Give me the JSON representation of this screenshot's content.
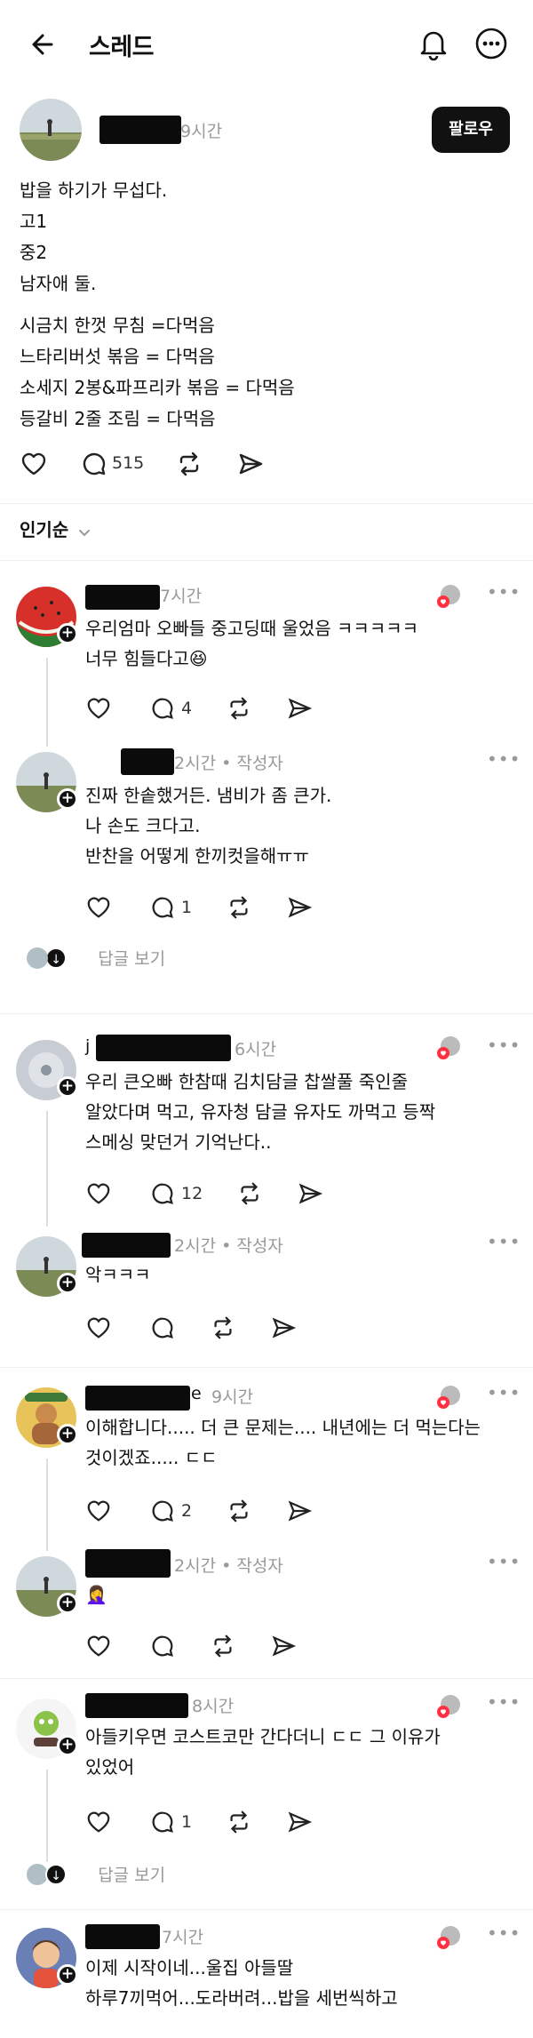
{
  "header": {
    "title": "스레드",
    "follow_label": "팔로우",
    "post_time": "9시간"
  },
  "post": {
    "lines": [
      "밥을 하기가 무섭다.",
      "고1",
      "중2",
      "남자애 둘.",
      "",
      "시금치 한껏  무침 =다먹음",
      "느타리버섯 볶음 = 다먹음",
      "소세지 2봉&파프리카 볶음 = 다먹음",
      "등갈비 2줄 조림 = 다먹음"
    ],
    "reply_count": "515"
  },
  "sort": {
    "label": "인기순"
  },
  "comments": [
    {
      "time": "7시간",
      "text": [
        "우리엄마 오빠들 중고딩때 울었음 ㅋㅋㅋㅋㅋ",
        "너무 힘들다고😆"
      ],
      "reply_count": "4"
    },
    {
      "time": "2시간 • 작성자",
      "text": [
        "진짜 한솥했거든. 냄비가 좀 큰가.",
        "나 손도 크다고.",
        "반찬을 어떻게 한끼컷을해ㅠㅠ"
      ],
      "reply_count": "1"
    },
    {
      "time": "6시간",
      "prefix": "j",
      "text": [
        "우리 큰오빠 한참때 김치담글 찹쌀풀 죽인줄",
        "알았다며 먹고, 유자청 담글 유자도 까먹고 등짝",
        "스메싱 맞던거 기억난다.."
      ],
      "reply_count": "12"
    },
    {
      "time": "2시간 • 작성자",
      "text": [
        "악ㅋㅋㅋ"
      ],
      "reply_count": ""
    },
    {
      "time": "9시간",
      "suffix": "e",
      "text": [
        "이해합니다..... 더 큰 문제는.... 내년에는 더 먹는다는",
        "것이겠죠..... ㄷㄷ"
      ],
      "reply_count": "2"
    },
    {
      "time": "2시간 • 작성자",
      "text": [
        "🤦‍♀️"
      ],
      "reply_count": ""
    },
    {
      "time": "8시간",
      "text": [
        "아들키우면 코스트코만 간다더니 ㄷㄷ 그 이유가",
        "있었어"
      ],
      "reply_count": "1"
    },
    {
      "time": "7시간",
      "text": [
        "이제 시작이네...울집 아들딸",
        "하루7끼먹어...도라버려...밥을 세번씩하고"
      ],
      "reply_count": ""
    }
  ],
  "view_replies_label": "답글 보기",
  "colors": {
    "accent": "#111111",
    "muted": "#999999",
    "divider": "#eeeeee"
  },
  "icons": [
    "back-arrow-icon",
    "bell-icon",
    "more-icon",
    "heart-icon",
    "comment-icon",
    "repost-icon",
    "share-icon",
    "chevron-down-icon"
  ]
}
